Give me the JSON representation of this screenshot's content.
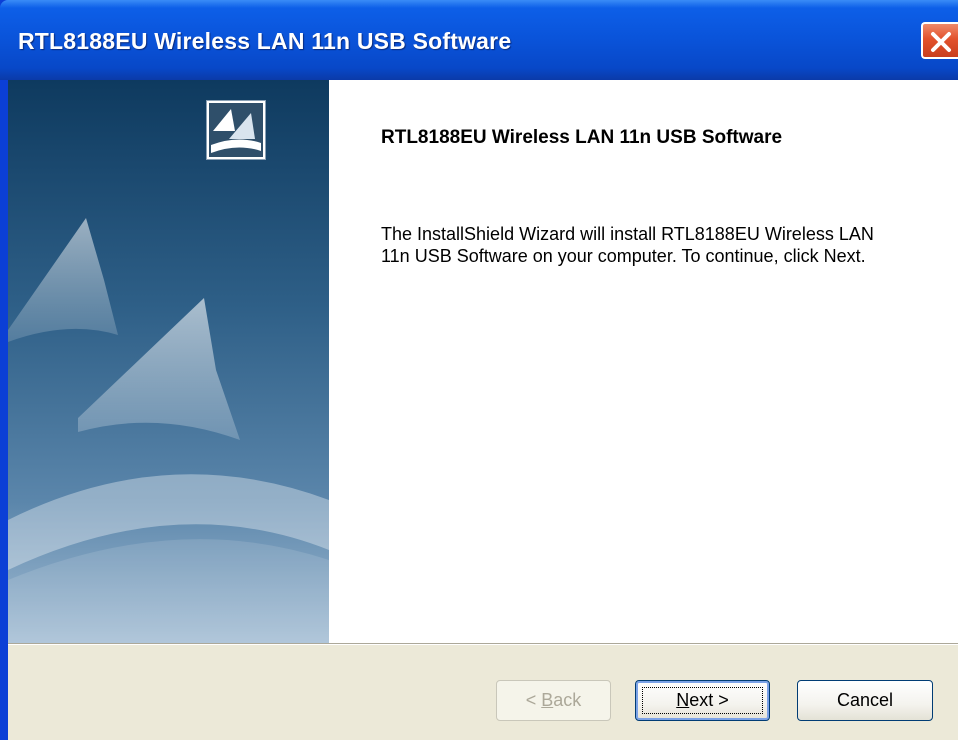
{
  "window": {
    "title": "RTL8188EU Wireless LAN 11n USB Software"
  },
  "content": {
    "heading": "RTL8188EU Wireless LAN 11n USB Software",
    "body": "The InstallShield Wizard will install RTL8188EU Wireless LAN 11n USB Software on your computer.  To continue, click Next."
  },
  "buttons": {
    "back": {
      "prefix": "< ",
      "accel": "B",
      "rest": "ack",
      "enabled": false
    },
    "next": {
      "accel": "N",
      "rest": "ext >",
      "enabled": true
    },
    "cancel": {
      "label": "Cancel",
      "enabled": true
    }
  },
  "colors": {
    "title_bar": "#0a53d9",
    "close_button": "#e2522d",
    "dialog_face": "#ece9d8"
  },
  "icons": [
    "installshield-logo-icon",
    "close-icon"
  ]
}
